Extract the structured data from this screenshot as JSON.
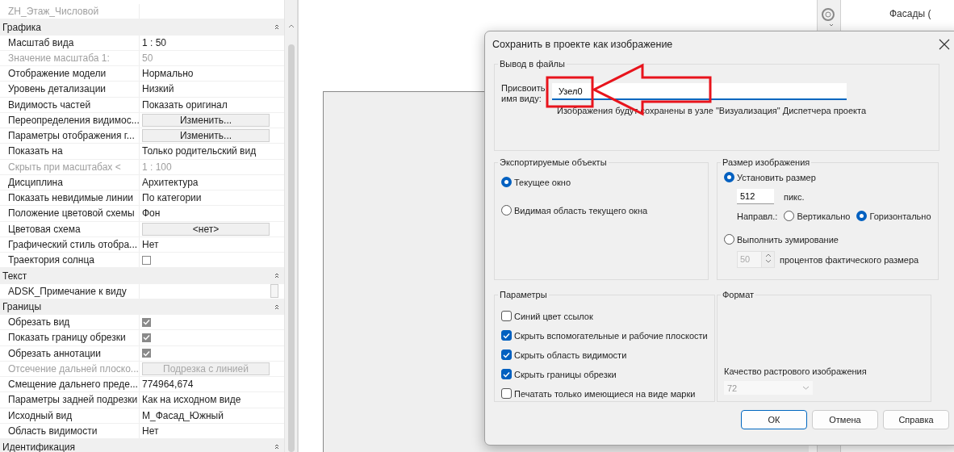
{
  "properties": {
    "top_row": {
      "label": "ZH_Этаж_Числовой",
      "disabled": true
    },
    "groups": [
      {
        "name": "Графика",
        "rows": [
          {
            "label": "Масштаб вида",
            "kind": "text",
            "value": "1 : 50",
            "disabled": false
          },
          {
            "label": "Значение масштаба    1:",
            "kind": "text",
            "value": "50",
            "disabled": true
          },
          {
            "label": "Отображение модели",
            "kind": "text",
            "value": "Нормально",
            "disabled": false
          },
          {
            "label": "Уровень детализации",
            "kind": "text",
            "value": "Низкий",
            "disabled": false
          },
          {
            "label": "Видимость частей",
            "kind": "text",
            "value": "Показать оригинал",
            "disabled": false
          },
          {
            "label": "Переопределения видимос...",
            "kind": "button",
            "value": "Изменить...",
            "disabled": false
          },
          {
            "label": "Параметры отображения г...",
            "kind": "button",
            "value": "Изменить...",
            "disabled": false
          },
          {
            "label": "Показать на",
            "kind": "text",
            "value": "Только родительский вид",
            "disabled": false
          },
          {
            "label": "Скрыть при масштабах <",
            "kind": "text",
            "value": "1 : 100",
            "disabled": true
          },
          {
            "label": "Дисциплина",
            "kind": "text",
            "value": "Архитектура",
            "disabled": false
          },
          {
            "label": "Показать невидимые линии",
            "kind": "text",
            "value": "По категории",
            "disabled": false
          },
          {
            "label": "Положение цветовой схемы",
            "kind": "text",
            "value": "Фон",
            "disabled": false
          },
          {
            "label": "Цветовая схема",
            "kind": "button",
            "value": "<нет>",
            "disabled": false
          },
          {
            "label": "Графический стиль отобра...",
            "kind": "text",
            "value": "Нет",
            "disabled": false
          },
          {
            "label": "Траектория солнца",
            "kind": "checkbox",
            "checked": false,
            "disabled": false
          }
        ]
      },
      {
        "name": "Текст",
        "rows": [
          {
            "label": "ADSK_Примечание к виду",
            "kind": "field",
            "disabled": false
          }
        ]
      },
      {
        "name": "Границы",
        "rows": [
          {
            "label": "Обрезать вид",
            "kind": "checkbox",
            "checked": true,
            "disabled": false
          },
          {
            "label": "Показать границу обрезки",
            "kind": "checkbox",
            "checked": true,
            "disabled": false
          },
          {
            "label": "Обрезать аннотации",
            "kind": "checkbox",
            "checked": true,
            "disabled": false
          },
          {
            "label": "Отсечение дальней плоско...",
            "kind": "button",
            "value": "Подрезка с линией",
            "disabled": true
          },
          {
            "label": "Смещение дальнего преде...",
            "kind": "text",
            "value": "774964,674",
            "disabled": false
          },
          {
            "label": "Параметры задней подрезки",
            "kind": "text",
            "value": "Как на исходном виде",
            "disabled": false
          },
          {
            "label": "Исходный вид",
            "kind": "text",
            "value": "М_Фасад_Южный",
            "disabled": false
          },
          {
            "label": "Область видимости",
            "kind": "text",
            "value": "Нет",
            "disabled": false
          }
        ]
      },
      {
        "name": "Идентификация"
      }
    ]
  },
  "browser": {
    "items": [
      "Фасады ("
    ]
  },
  "dialog": {
    "title": "Сохранить в проекте как изображение",
    "output": {
      "legend": "Вывод в файлы",
      "name_label": "Присвоить имя виду:",
      "name_value": "Узел0",
      "note": "Изображения будут сохранены в узле \"Визуализация\" Диспетчера проекта"
    },
    "export": {
      "legend": "Экспортируемые объекты",
      "options": [
        {
          "label": "Текущее окно",
          "selected": true
        },
        {
          "label": "Видимая область текущего окна",
          "selected": false
        }
      ]
    },
    "size": {
      "legend": "Размер изображения",
      "set_size": {
        "label": "Установить размер",
        "selected": true
      },
      "pixels": "512",
      "pixels_unit": "пикс.",
      "direction_label": "Направл.:",
      "directions": [
        {
          "label": "Вертикально",
          "selected": false
        },
        {
          "label": "Горизонтально",
          "selected": true
        }
      ],
      "zoom": {
        "label": "Выполнить зумирование",
        "selected": false
      },
      "zoom_value": "50",
      "zoom_disabled": true,
      "zoom_unit": "процентов фактического размера"
    },
    "params": {
      "legend": "Параметры",
      "options": [
        {
          "label": "Синий цвет ссылок",
          "checked": false
        },
        {
          "label": "Скрыть вспомогательные и рабочие плоскости",
          "checked": true
        },
        {
          "label": "Скрыть область видимости",
          "checked": true
        },
        {
          "label": "Скрыть границы обрезки",
          "checked": true
        },
        {
          "label": "Печатать только имеющиеся на виде марки",
          "checked": false
        }
      ]
    },
    "format": {
      "legend": "Формат",
      "quality_label": "Качество растрового изображения",
      "quality_value": "72",
      "quality_disabled": true
    },
    "buttons": [
      {
        "label": "ОК",
        "focused": true
      },
      {
        "label": "Отмена",
        "focused": false
      },
      {
        "label": "Справка",
        "focused": false
      }
    ]
  }
}
